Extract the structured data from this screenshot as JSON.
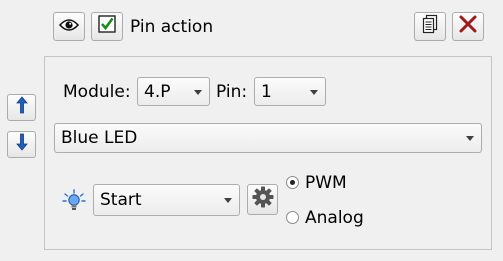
{
  "header": {
    "title": "Pin action",
    "visibility_icon": "eye-icon",
    "enabled_checked": true,
    "copy_icon": "copy-document-icon",
    "delete_icon": "close-x-icon",
    "delete_color": "#a01818"
  },
  "side_buttons": {
    "up_icon": "arrow-up-icon",
    "down_icon": "arrow-down-icon",
    "arrow_color": "#1f5fbf"
  },
  "module": {
    "label": "Module:",
    "value": "4.P"
  },
  "pin": {
    "label": "Pin:",
    "value": "1"
  },
  "device": {
    "value": "Blue LED"
  },
  "action": {
    "bulb_icon": "light-bulb-icon",
    "value": "Start",
    "settings_icon": "gear-icon"
  },
  "mode": {
    "options": [
      "PWM",
      "Analog"
    ],
    "selected": "PWM"
  }
}
